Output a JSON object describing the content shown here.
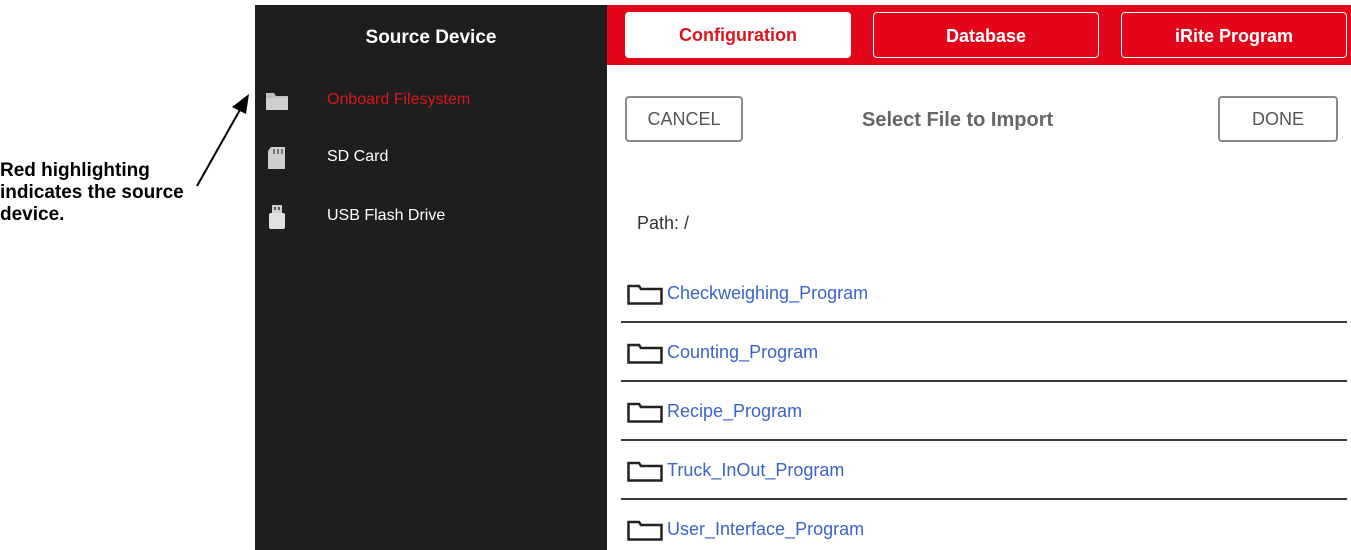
{
  "annotation": {
    "lines": [
      "Red highlighting",
      "indicates the source",
      "device."
    ]
  },
  "sidebar": {
    "title": "Source Device",
    "items": [
      {
        "label": "Onboard Filesystem",
        "icon": "folder-icon",
        "active": true
      },
      {
        "label": "SD Card",
        "icon": "sd-card-icon",
        "active": false
      },
      {
        "label": "USB Flash Drive",
        "icon": "usb-drive-icon",
        "active": false
      }
    ]
  },
  "tabs": [
    {
      "label": "Configuration",
      "active": true
    },
    {
      "label": "Database",
      "active": false
    },
    {
      "label": "iRite Program",
      "active": false
    }
  ],
  "dialog": {
    "cancel_label": "CANCEL",
    "title": "Select File to Import",
    "done_label": "DONE",
    "path": "Path: /"
  },
  "files": [
    {
      "name": "Checkweighing_Program",
      "icon": "folder-icon"
    },
    {
      "name": "Counting_Program",
      "icon": "folder-icon"
    },
    {
      "name": "Recipe_Program",
      "icon": "folder-icon"
    },
    {
      "name": "Truck_InOut_Program",
      "icon": "folder-icon"
    },
    {
      "name": "User_Interface_Program",
      "icon": "folder-icon"
    }
  ],
  "colors": {
    "accent_red": "#e3061a",
    "sidebar_bg": "#1e1e1e",
    "link_blue": "#3a64c8"
  }
}
